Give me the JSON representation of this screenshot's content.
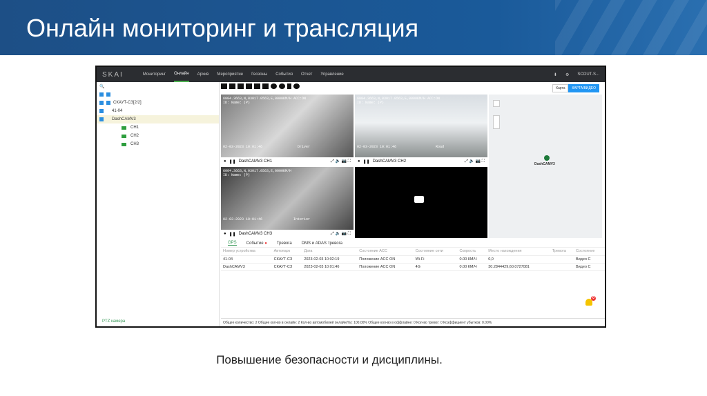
{
  "slide": {
    "title": "Онлайн мониторинг и трансляция",
    "caption": "Повышение безопасности и дисциплины."
  },
  "nav": {
    "logo": "SKAI",
    "items": [
      "Мониторинг",
      "Онлайн",
      "Архив",
      "Мероприятие",
      "Геозоны",
      "События",
      "Отчет",
      "Управление"
    ],
    "user": "SCOUT-S..."
  },
  "tree": {
    "group": "СКАУТ-СЗ[2/2]",
    "devices": [
      "41-04",
      "DashCAMV3"
    ],
    "channels": [
      "CH1",
      "CH2",
      "CH3"
    ],
    "ptz": "PTZ камера"
  },
  "map": {
    "buttons": [
      "Карта",
      "КАРТА/ВИДЕО"
    ],
    "marker": "DashCAMV3"
  },
  "videos": [
    {
      "osd1": "6004.3663,N,03017.0563,E,0000KM/H ACC:ON",
      "osd2": "ID: Name: (P)",
      "time": "02-03-2023 10:01:46",
      "tag": "Driver",
      "label": "DashCAMV3 CH1"
    },
    {
      "osd1": "6004.3663,N,03017.0563,E,0000KM/H ACC:ON",
      "osd2": "ID: Name: (P)",
      "time": "02-03-2023 10:01:46",
      "tag": "Road",
      "label": "DashCAMV3 CH2"
    },
    {
      "osd1": "6004.3663,N,03017.0563,E,0000KM/H",
      "osd2": "ID: Name: (P)",
      "time": "02-03-2023 10:01:46",
      "tag": "Interior",
      "label": "DashCAMV3 CH3"
    }
  ],
  "panel": {
    "tabs": [
      "GPS",
      "Событие",
      "Тревога",
      "DMS и ADAS тревога"
    ],
    "columns": [
      "Номер устройства",
      "Автопарк",
      "Дата",
      "Состояние ACC",
      "Состояние сети",
      "Скорость",
      "Место нахождения",
      "Тревога",
      "Состояние"
    ],
    "rows": [
      [
        "41-04",
        "СКАУТ-СЗ",
        "2023-02-03 10:02:19",
        "Положение ACC ON",
        "Wi-Fi",
        "0.00 КМ/Ч",
        "0,0",
        "",
        "Видео С"
      ],
      [
        "DashCAMV3",
        "СКАУТ-СЗ",
        "2023-02-03 10:01:46",
        "Положение ACC ON",
        "4G",
        "0.00 КМ/Ч",
        "30.2844429,60.0727081",
        "",
        "Видео С"
      ]
    ]
  },
  "status": "Общее количество: 2 Общее кол-во в онлайн: 2 Кол-во автомобилей онлайн(%): 100.00% Общее кол-во в оффлайне: 0 Кол-во тревог: 0 Коэффициент убытков: 0.00%",
  "bell_count": "0"
}
